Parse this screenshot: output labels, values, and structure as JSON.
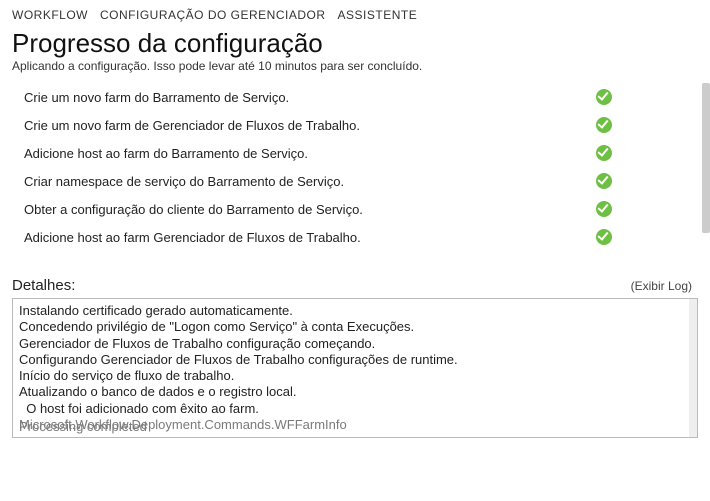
{
  "nav": {
    "workflow": "WORKFLOW",
    "config": "CONFIGURAÇÃO DO GERENCIADOR",
    "assistant": "ASSISTENTE"
  },
  "title": "Progresso da configuração",
  "subtitle": "Aplicando a configuração. Isso pode levar até 10 minutos para ser concluído.",
  "steps": [
    {
      "label": "Crie um novo farm do Barramento de Serviço.",
      "done": true
    },
    {
      "label": "Crie um novo farm de Gerenciador de Fluxos de Trabalho.",
      "done": true
    },
    {
      "label": "Adicione host ao farm do Barramento de Serviço.",
      "done": true
    },
    {
      "label": "Criar namespace de serviço do Barramento de Serviço.",
      "done": true
    },
    {
      "label": "Obter a configuração do cliente do Barramento de Serviço.",
      "done": true
    },
    {
      "label": "Adicione host ao farm Gerenciador de Fluxos de Trabalho.",
      "done": true
    }
  ],
  "details": {
    "header": "Detalhes:",
    "show_log": "(Exibir Log)",
    "lines": [
      "Instalando certificado gerado automaticamente.",
      "Concedendo privilégio de \"Logon como Serviço\" à conta Execuções.",
      "Gerenciador de Fluxos de Trabalho configuração começando.",
      "Configurando Gerenciador de Fluxos de Trabalho configurações de runtime.",
      "Início do serviço de fluxo de trabalho.",
      "Atualizando o banco de dados e o registro local.",
      "  O host foi adicionado com êxito ao farm."
    ],
    "gray_line": "Microsoft.Workflow.Deployment.Commands.WFFarmInfo",
    "processing": "Processing completed"
  }
}
